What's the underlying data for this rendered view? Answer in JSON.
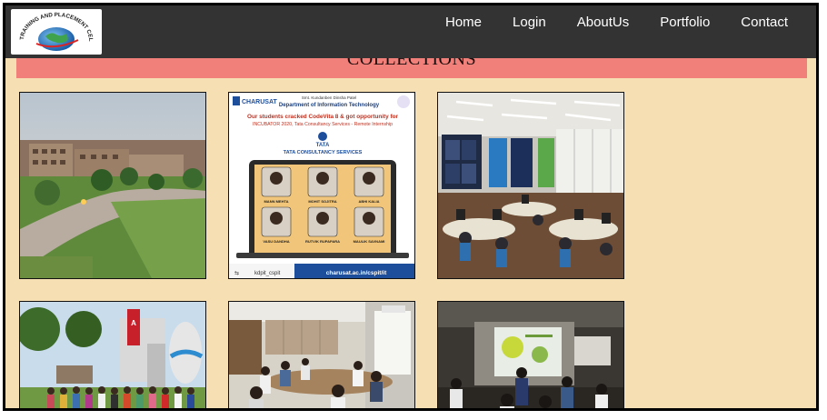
{
  "navbar": {
    "logo_text": "TRAINING AND PLACEMENT CELL",
    "links": [
      "Home",
      "Login",
      "AboutUs",
      "Portfolio",
      "Contact"
    ]
  },
  "banner": {
    "title": "COLLECTIONS"
  },
  "poster": {
    "institution": "CHARUSAT",
    "college": "Smt. Kundanben Dinsha Patel",
    "department": "Department of Information Technology",
    "headline": "Our students cracked CodeVita 8 & got opportunity for",
    "subline": "INCUBATOR 2020, Tata Consultancy Services - Remote Internship",
    "company_logo": "TATA",
    "company_name": "TATA CONSULTANCY SERVICES",
    "students": [
      "MANN MEHTA",
      "MOHIT SOJITRA",
      "ABHI KALIA",
      "VASU DANDHA",
      "RUTVIK RUPAPARA",
      "MAULIK SAVNAMI"
    ],
    "handle": "kdpit_cspit",
    "url": "charusat.ac.in/cspit/it"
  },
  "gallery": {
    "alts": [
      "campus-photo",
      "codevita-poster",
      "computer-lab-photo",
      "group-photo-outdoor",
      "meeting-room-photo",
      "presentation-room-photo"
    ]
  }
}
